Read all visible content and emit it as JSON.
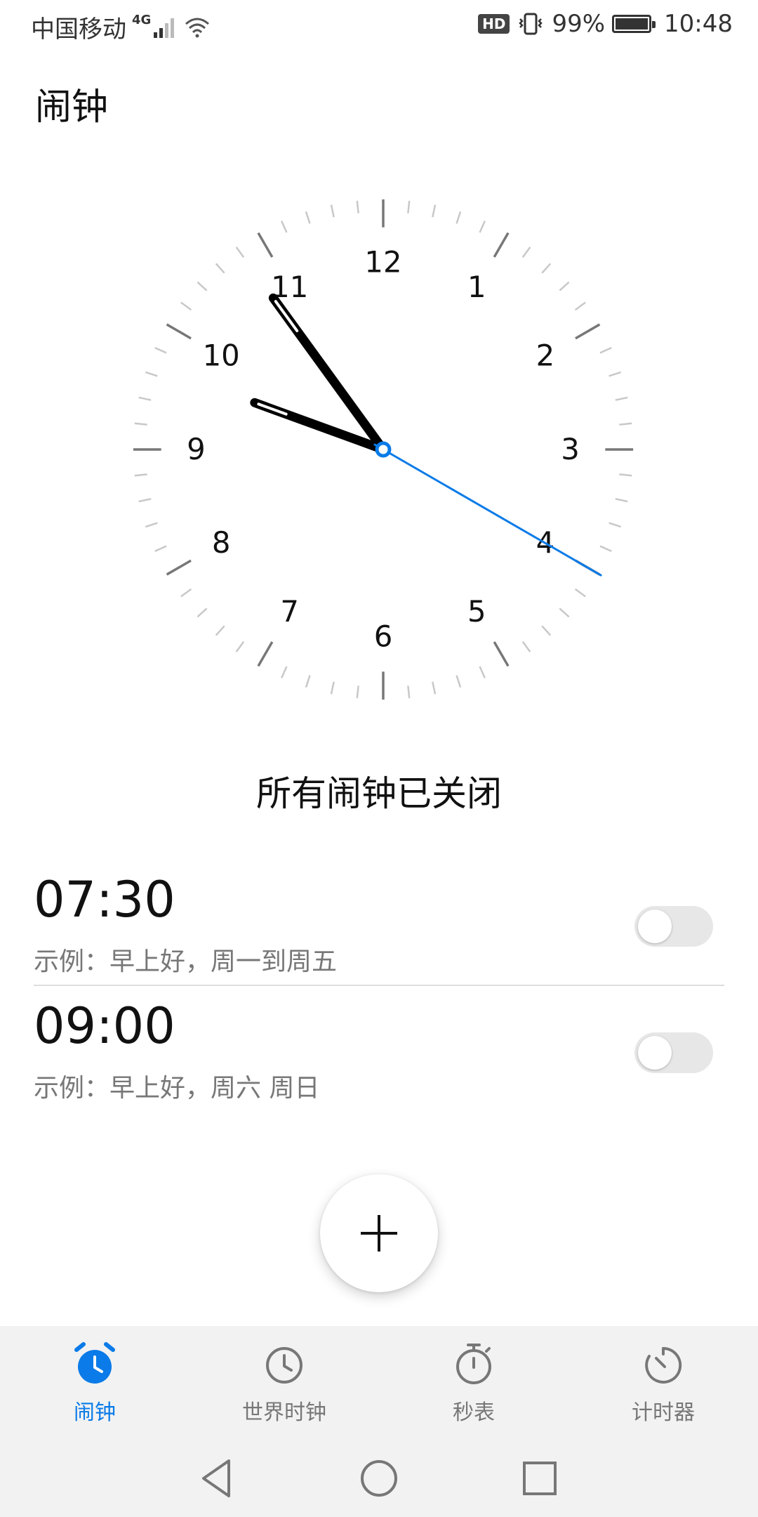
{
  "status_bar": {
    "carrier": "中国移动",
    "network": "4G",
    "hd": "HD",
    "battery_percent": "99%",
    "battery_level": 0.99,
    "time": "10:48"
  },
  "page": {
    "title": "闹钟"
  },
  "clock": {
    "numbers": [
      "12",
      "1",
      "2",
      "3",
      "4",
      "5",
      "6",
      "7",
      "8",
      "9",
      "10",
      "11"
    ],
    "hour": 10,
    "minute": 48,
    "second": 20,
    "second_hand_color": "#0a7be8"
  },
  "alarm_status": "所有闹钟已关闭",
  "alarms": [
    {
      "time": "07:30",
      "label": "示例：早上好，周一到周五",
      "enabled": false
    },
    {
      "time": "09:00",
      "label": "示例：早上好，周六 周日",
      "enabled": false
    }
  ],
  "fab": {
    "icon": "plus-icon"
  },
  "bottom_nav": {
    "items": [
      {
        "label": "闹钟",
        "icon": "alarm-clock-icon",
        "active": true
      },
      {
        "label": "世界时钟",
        "icon": "world-clock-icon",
        "active": false
      },
      {
        "label": "秒表",
        "icon": "stopwatch-icon",
        "active": false
      },
      {
        "label": "计时器",
        "icon": "timer-icon",
        "active": false
      }
    ],
    "active_color": "#0a7be8",
    "inactive_color": "#777777"
  },
  "system_nav": {
    "back": "back-icon",
    "home": "home-icon",
    "recents": "recents-icon"
  }
}
